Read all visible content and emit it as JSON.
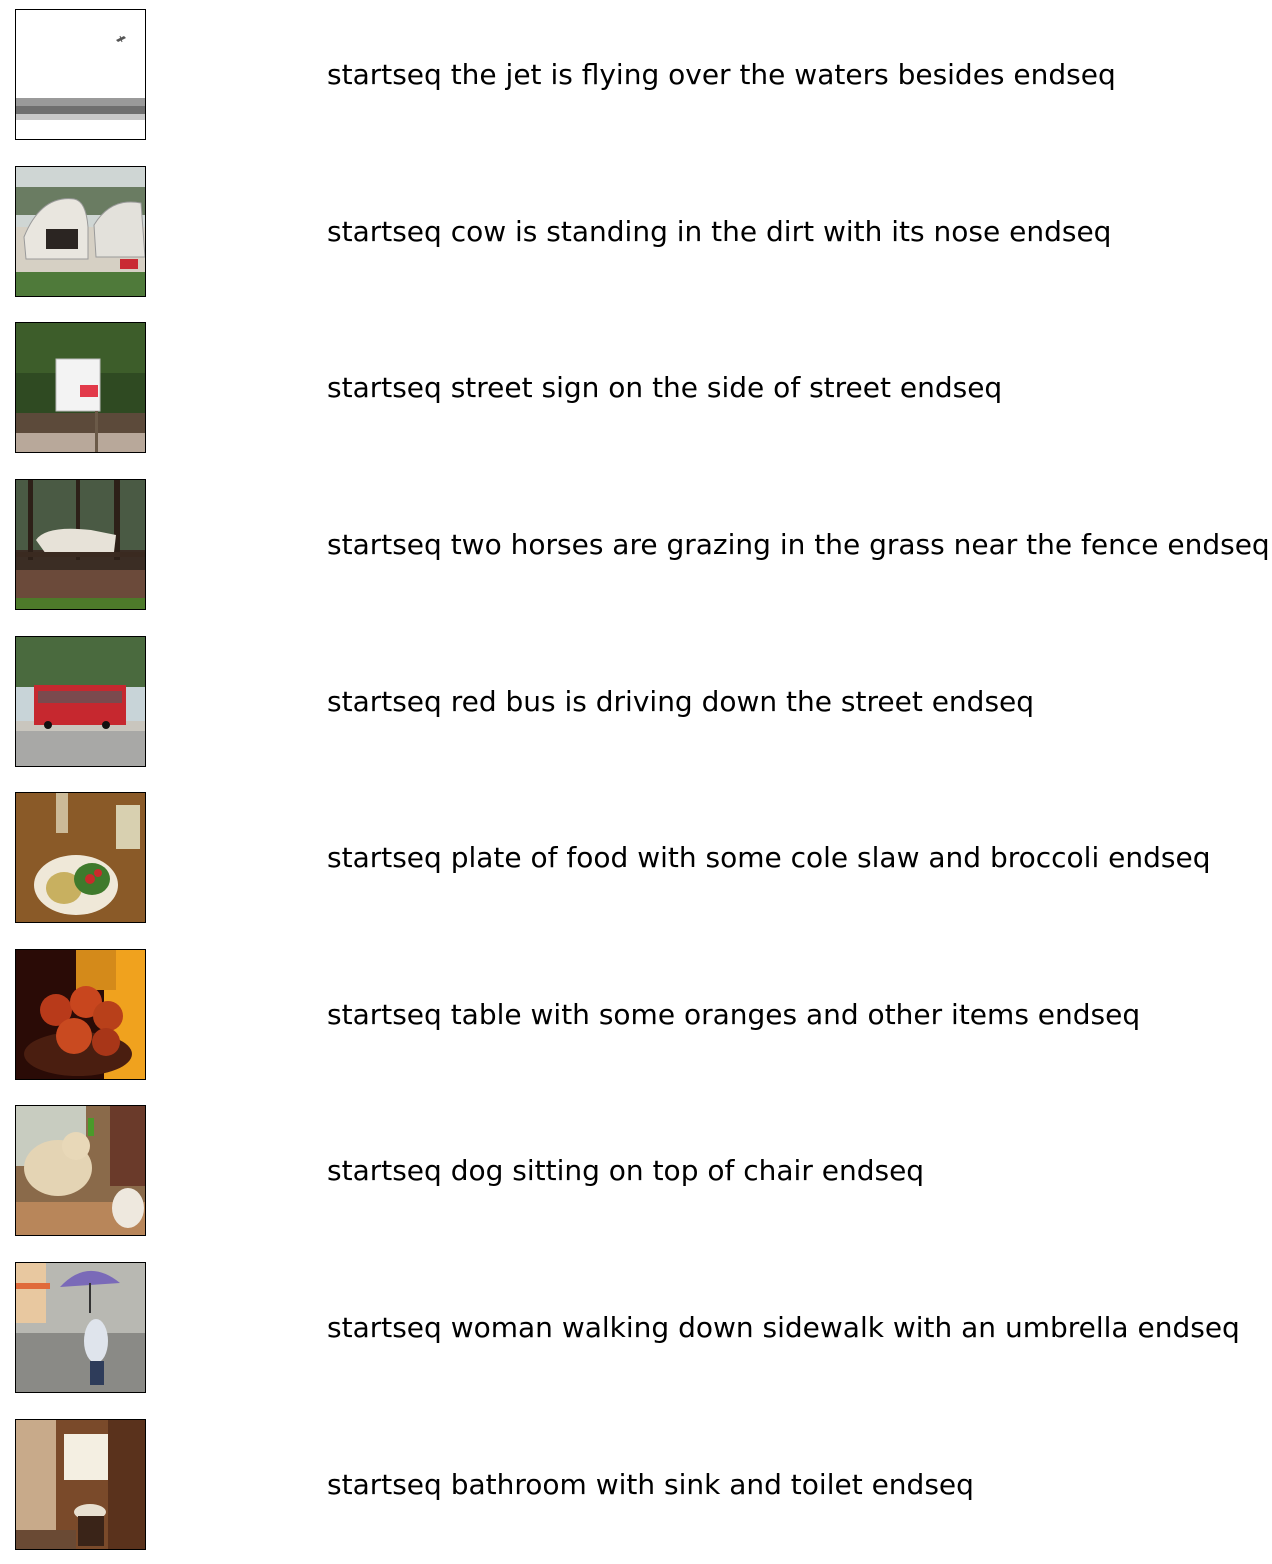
{
  "items": [
    {
      "caption": "startseq the jet is flying over the waters besides endseq",
      "image": "jet-over-water"
    },
    {
      "caption": "startseq cow is standing in the dirt with its nose endseq",
      "image": "cow-in-pen"
    },
    {
      "caption": "startseq street sign on the side of street endseq",
      "image": "street-sign"
    },
    {
      "caption": "startseq two horses are grazing in the grass near the fence endseq",
      "image": "horse-by-fence"
    },
    {
      "caption": "startseq red bus is driving down the street endseq",
      "image": "red-bus"
    },
    {
      "caption": "startseq plate of food with some cole slaw and broccoli endseq",
      "image": "plate-of-food"
    },
    {
      "caption": "startseq table with some oranges and other items endseq",
      "image": "fruit-bowl"
    },
    {
      "caption": "startseq dog sitting on top of chair endseq",
      "image": "dog-indoors"
    },
    {
      "caption": "startseq woman walking down sidewalk with an umbrella endseq",
      "image": "woman-with-umbrella"
    },
    {
      "caption": "startseq bathroom with sink and toilet endseq",
      "image": "bathroom"
    }
  ]
}
